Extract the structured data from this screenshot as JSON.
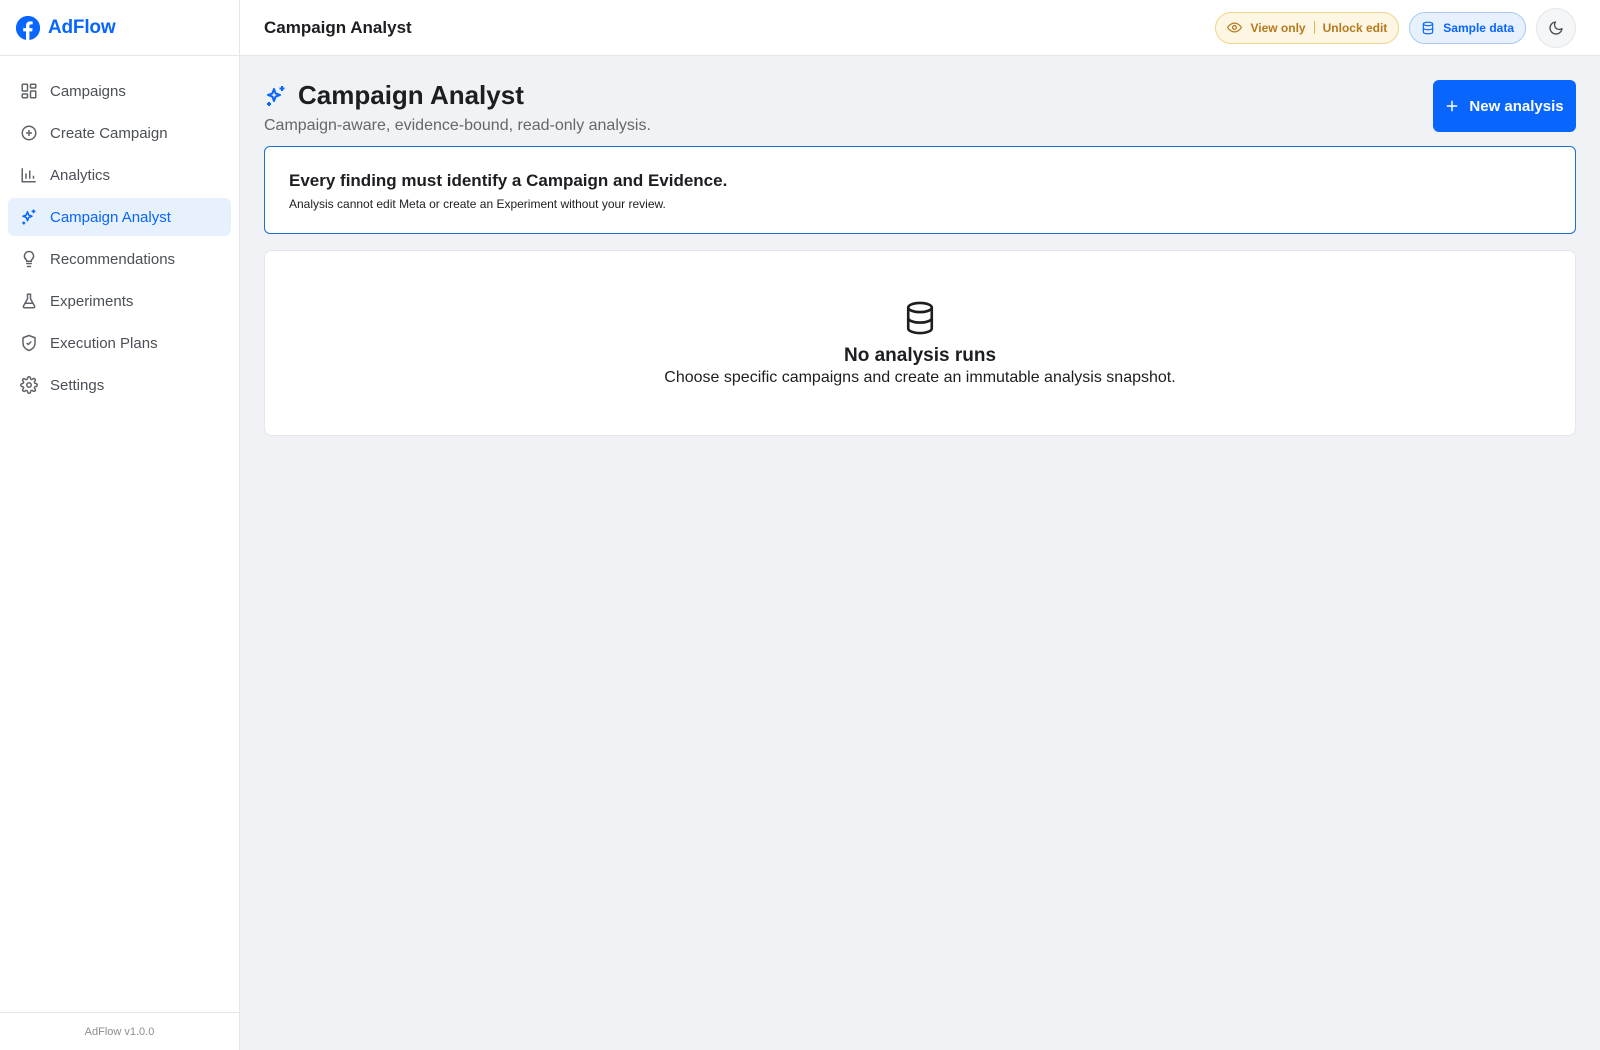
{
  "brand": {
    "name": "AdFlow",
    "accent": "#0866ff"
  },
  "sidebar": {
    "items": [
      {
        "label": "Campaigns",
        "icon": "grid-icon",
        "active": false
      },
      {
        "label": "Create Campaign",
        "icon": "plus-circle-icon",
        "active": false
      },
      {
        "label": "Analytics",
        "icon": "bar-chart-icon",
        "active": false
      },
      {
        "label": "Campaign Analyst",
        "icon": "sparkles-icon",
        "active": true
      },
      {
        "label": "Recommendations",
        "icon": "lightbulb-icon",
        "active": false
      },
      {
        "label": "Experiments",
        "icon": "flask-icon",
        "active": false
      },
      {
        "label": "Execution Plans",
        "icon": "shield-check-icon",
        "active": false
      },
      {
        "label": "Settings",
        "icon": "gear-icon",
        "active": false
      }
    ],
    "footer": "AdFlow v1.0.0"
  },
  "topbar": {
    "title": "Campaign Analyst",
    "view_only": "View only",
    "unlock_edit": "Unlock edit",
    "sample_data": "Sample data",
    "theme_icon": "moon-icon"
  },
  "page": {
    "title": "Campaign Analyst",
    "subtitle": "Campaign-aware, evidence-bound, read-only analysis.",
    "new_analysis": "New analysis"
  },
  "notice": {
    "title": "Every finding must identify a Campaign and Evidence.",
    "text": "Analysis cannot edit Meta or create an Experiment without your review."
  },
  "empty": {
    "icon": "database-icon",
    "title": "No analysis runs",
    "text": "Choose specific campaigns and create an immutable analysis snapshot."
  }
}
